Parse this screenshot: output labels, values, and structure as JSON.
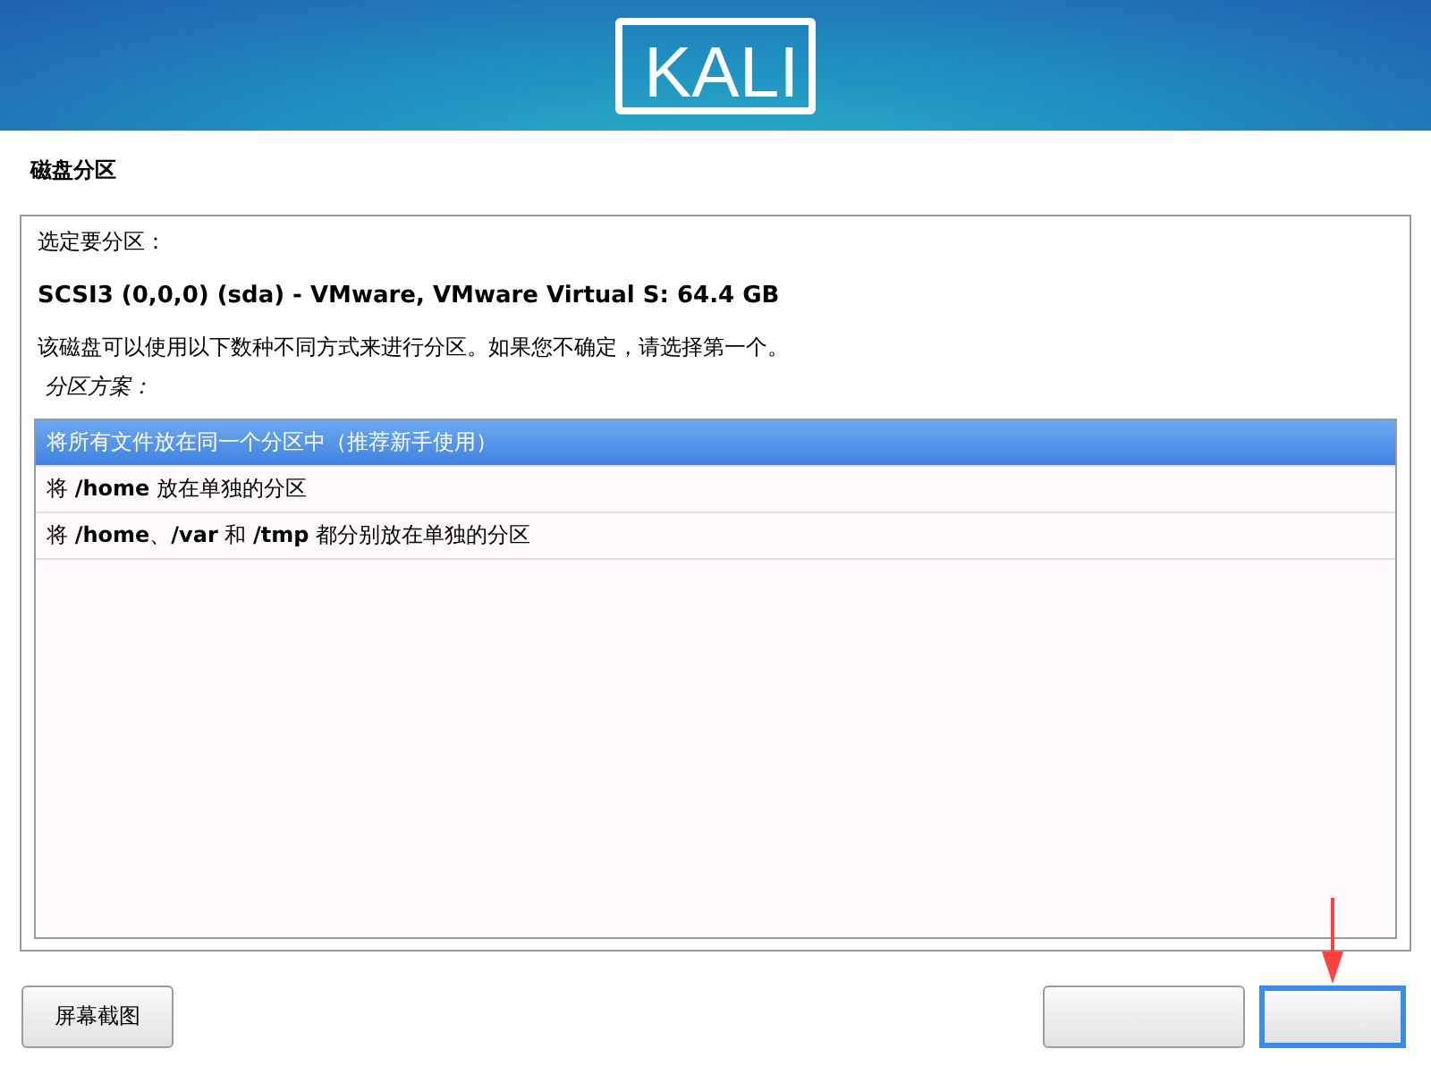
{
  "header": {
    "logo": "KALI"
  },
  "title": "磁盘分区",
  "prompt": "选定要分区：",
  "disk": "SCSI3 (0,0,0) (sda) - VMware, VMware Virtual S: 64.4 GB",
  "description": "该磁盘可以使用以下数种不同方式来进行分区。如果您不确定，请选择第一个。",
  "scheme_label": "分区方案：",
  "options": [
    {
      "label": "将所有文件放在同一个分区中（推荐新手使用）",
      "selected": true
    },
    {
      "label": "将 **/home** 放在单独的分区",
      "selected": false
    },
    {
      "label": "将 **/home**、**/var** 和 **/tmp** 都分别放在单独的分区",
      "selected": false
    }
  ],
  "buttons": [
    {
      "label": "屏幕截图",
      "focused": false
    },
    {
      "focused": false
    },
    {
      "focused": true
    }
  ]
}
